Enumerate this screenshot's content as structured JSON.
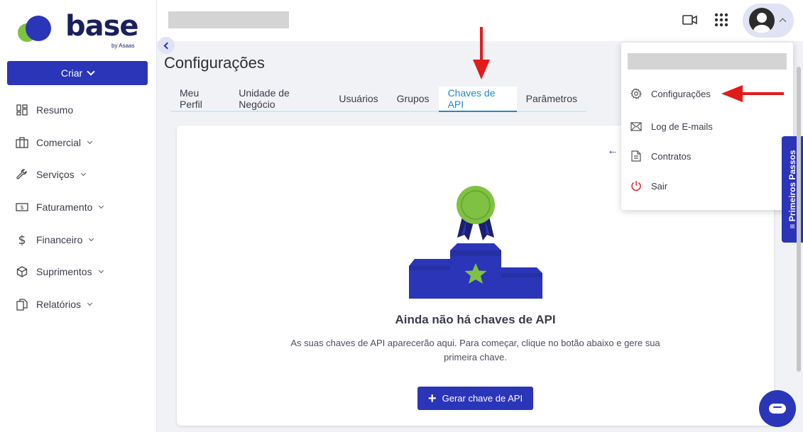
{
  "brand": {
    "logo_text": "base",
    "logo_sub": "by Asaas"
  },
  "sidebar": {
    "create_label": "Criar",
    "items": [
      {
        "label": "Resumo",
        "icon": "dashboard-icon",
        "has_submenu": false
      },
      {
        "label": "Comercial",
        "icon": "briefcase-icon",
        "has_submenu": true
      },
      {
        "label": "Serviços",
        "icon": "wrench-icon",
        "has_submenu": true
      },
      {
        "label": "Faturamento",
        "icon": "banknote-icon",
        "has_submenu": true
      },
      {
        "label": "Financeiro",
        "icon": "dollar-icon",
        "has_submenu": true
      },
      {
        "label": "Suprimentos",
        "icon": "box-icon",
        "has_submenu": true
      },
      {
        "label": "Relatórios",
        "icon": "documents-icon",
        "has_submenu": true
      }
    ]
  },
  "header": {
    "icons": [
      "video-icon",
      "apps-grid-icon",
      "avatar-icon"
    ]
  },
  "page": {
    "title": "Configurações",
    "tabs": [
      {
        "label": "Meu Perfil",
        "active": false
      },
      {
        "label": "Unidade de Negócio",
        "active": false
      },
      {
        "label": "Usuários",
        "active": false
      },
      {
        "label": "Grupos",
        "active": false
      },
      {
        "label": "Chaves de API",
        "active": true
      },
      {
        "label": "Parâmetros",
        "active": false
      }
    ]
  },
  "empty_state": {
    "title": "Ainda não há chaves de API",
    "description": "As suas chaves de API aparecerão aqui. Para começar, clique no botão abaixo e gere sua primeira chave.",
    "button_label": "Gerar chave de API",
    "illustration": "podium-award-icon"
  },
  "user_menu": {
    "items": [
      {
        "label": "Configurações",
        "icon": "gear-icon"
      },
      {
        "label": "Log de E-mails",
        "icon": "envelope-icon"
      },
      {
        "label": "Contratos",
        "icon": "document-icon"
      },
      {
        "label": "Sair",
        "icon": "power-icon"
      }
    ]
  },
  "side_tab": {
    "label": "Primeiros Passos"
  },
  "colors": {
    "primary": "#2b35b8",
    "accent_tab": "#1c8ad6",
    "logo_green": "#7fc241",
    "annotation_red": "#e21b1b"
  }
}
